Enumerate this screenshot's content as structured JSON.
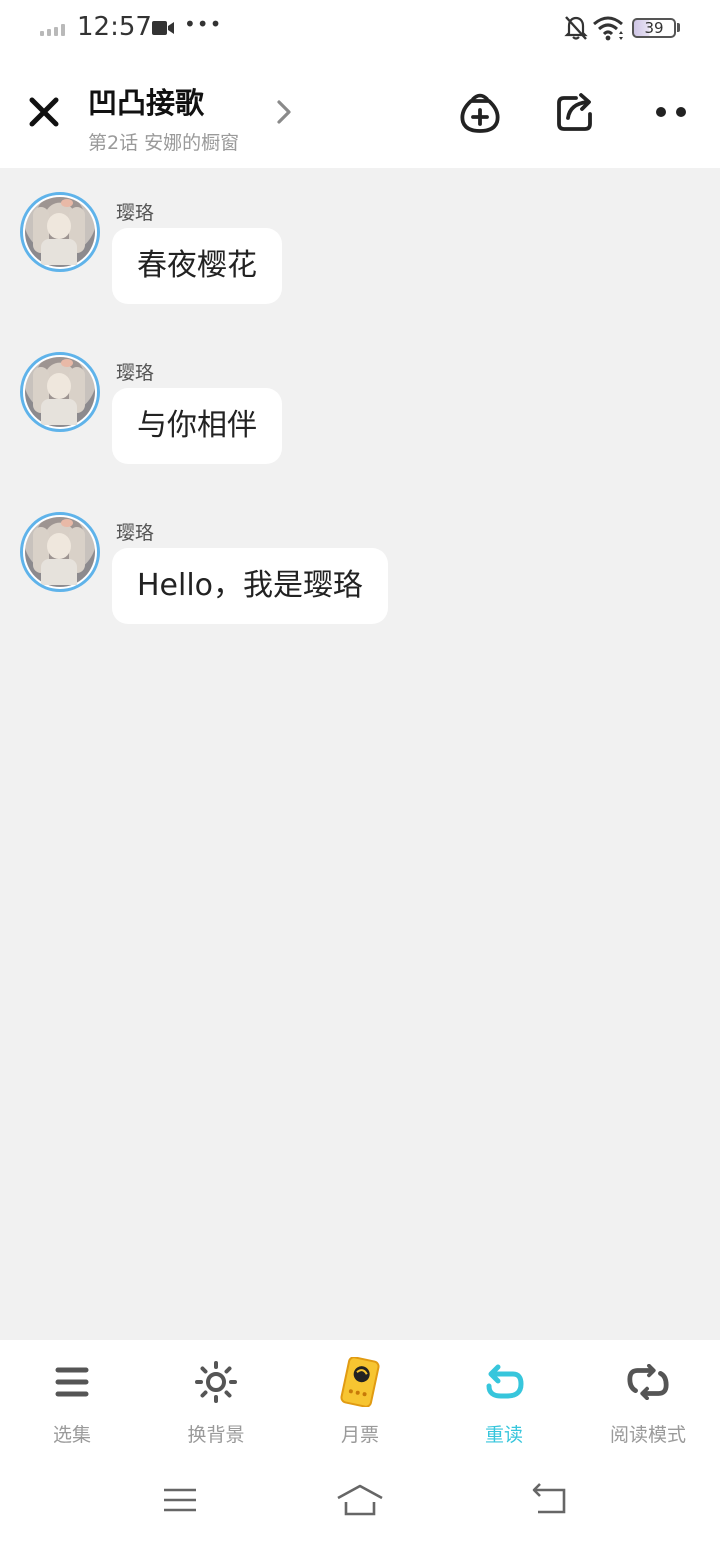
{
  "status_bar": {
    "time": "12:57",
    "dots": "•••",
    "battery": "39",
    "icons": [
      "signal-icon",
      "video-camera-icon",
      "bell-off-icon",
      "wifi-icon",
      "battery-icon"
    ]
  },
  "header": {
    "title": "凹凸接歌",
    "subtitle": "第2话 安娜的橱窗",
    "icons": [
      "close-icon",
      "chevron-right-icon",
      "coin-bag-add-icon",
      "share-icon",
      "more-icon"
    ]
  },
  "messages": [
    {
      "sender": "璎珞",
      "text": "春夜樱花"
    },
    {
      "sender": "璎珞",
      "text": "与你相伴"
    },
    {
      "sender": "璎珞",
      "text": "Hello，我是璎珞"
    }
  ],
  "toolbar": {
    "items": [
      {
        "label": "选集",
        "icon": "list-icon"
      },
      {
        "label": "换背景",
        "icon": "sun-icon"
      },
      {
        "label": "月票",
        "icon": "monthly-ticket-icon"
      },
      {
        "label": "重读",
        "icon": "reread-icon",
        "active": true
      },
      {
        "label": "阅读模式",
        "icon": "reading-mode-icon"
      }
    ]
  },
  "navbar": {
    "icons": [
      "menu-icon",
      "home-icon",
      "back-icon"
    ]
  },
  "colors": {
    "accent": "#37c6dc",
    "avatar_border": "#5fb3ea",
    "chat_background": "#f1f1f1",
    "ticket_yellow": "#f7c531"
  }
}
